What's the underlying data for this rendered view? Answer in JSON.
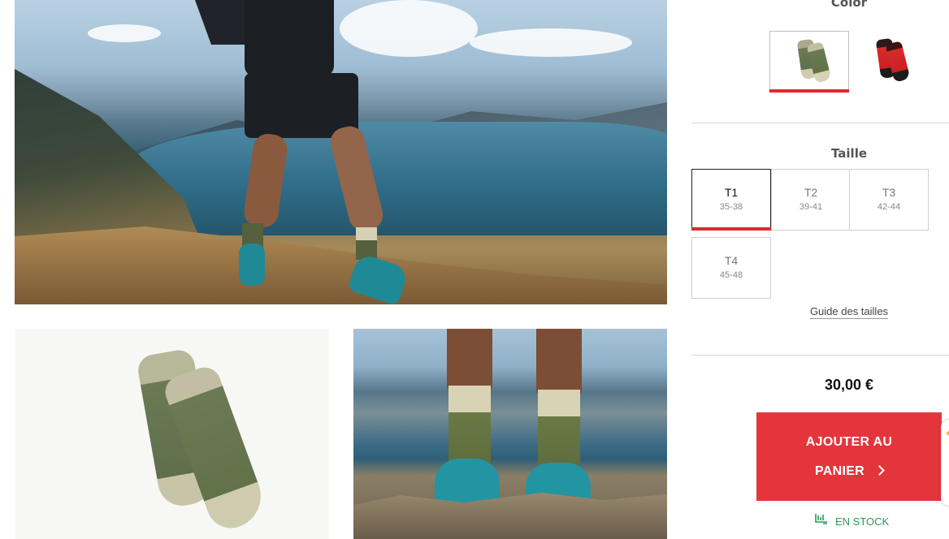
{
  "color_section": {
    "title": "Color"
  },
  "colors": [
    {
      "name": "green",
      "selected": true
    },
    {
      "name": "red-black",
      "selected": false
    }
  ],
  "size_section": {
    "title": "Taille"
  },
  "sizes": [
    {
      "label": "T1",
      "range": "35-38",
      "selected": true
    },
    {
      "label": "T2",
      "range": "39-41",
      "selected": false
    },
    {
      "label": "T3",
      "range": "42-44",
      "selected": false
    },
    {
      "label": "T4",
      "range": "45-48",
      "selected": false
    }
  ],
  "size_guide": "Guide des tailles",
  "price": "30,00 €",
  "cart_button": {
    "line1": "AJOUTER AU",
    "line2": "PANIER"
  },
  "stock": {
    "label": "EN STOCK",
    "icon": "stock-icon"
  },
  "accent_color": "#e4353c"
}
